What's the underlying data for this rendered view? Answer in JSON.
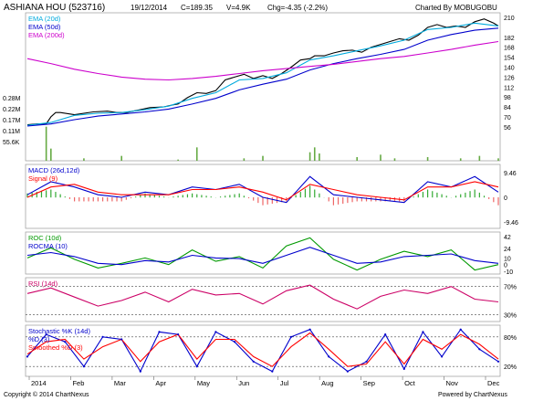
{
  "header": {
    "symbol": "ASHIANA HOU (523716)",
    "date": "19/12/2014",
    "close": "C=189.35",
    "volume": "V=4.9K",
    "change": "Chg=-4.35 (-2.2%)",
    "charted_by": "Charted By MOBUGOBU"
  },
  "footer": {
    "copyright": "Copyright © 2014 ChartNexus",
    "powered": "Powered by ChartNexus"
  },
  "x_axis": {
    "months": [
      "2014",
      "Feb",
      "Mar",
      "Apr",
      "May",
      "Jun",
      "Jul",
      "Aug",
      "Sep",
      "Oct",
      "Nov",
      "Dec"
    ]
  },
  "chart_data": [
    {
      "type": "line",
      "panel": "price",
      "legend": [
        {
          "name": "EMA (20d)",
          "color": "#00aadd"
        },
        {
          "name": "EMA (50d)",
          "color": "#0000cc"
        },
        {
          "name": "EMA (200d)",
          "color": "#cc00cc"
        }
      ],
      "y_ticks": [
        210,
        182,
        168,
        154,
        140,
        126,
        112,
        98,
        84,
        70,
        56
      ],
      "ylim": [
        48,
        214
      ],
      "volume_ticks": [
        "0.28M",
        "0.22M",
        "0.17M",
        "0.11M",
        "55.6K"
      ],
      "series": [
        {
          "name": "Price",
          "color": "#000000",
          "x": [
            0,
            0.02,
            0.04,
            0.05,
            0.06,
            0.07,
            0.1,
            0.14,
            0.17,
            0.19,
            0.21,
            0.24,
            0.26,
            0.29,
            0.31,
            0.32,
            0.34,
            0.36,
            0.38,
            0.4,
            0.42,
            0.44,
            0.46,
            0.48,
            0.5,
            0.52,
            0.54,
            0.56,
            0.58,
            0.6,
            0.61,
            0.63,
            0.65,
            0.67,
            0.69,
            0.71,
            0.73,
            0.75,
            0.77,
            0.79,
            0.81,
            0.83,
            0.85,
            0.87,
            0.89,
            0.91,
            0.93,
            0.95,
            0.97,
            0.99,
            1.0
          ],
          "values": [
            59,
            60,
            60,
            70,
            76,
            76,
            73,
            77,
            78,
            76,
            76,
            80,
            83,
            84,
            87,
            88,
            97,
            104,
            103,
            107,
            122,
            126,
            130,
            124,
            128,
            124,
            131,
            140,
            150,
            152,
            156,
            156,
            160,
            163,
            164,
            161,
            168,
            172,
            176,
            180,
            178,
            185,
            196,
            200,
            196,
            198,
            196,
            204,
            208,
            202,
            198
          ]
        },
        {
          "name": "EMA (20d)",
          "color": "#00aadd",
          "x": [
            0,
            0.05,
            0.1,
            0.15,
            0.2,
            0.25,
            0.3,
            0.35,
            0.4,
            0.45,
            0.5,
            0.55,
            0.6,
            0.65,
            0.7,
            0.75,
            0.8,
            0.85,
            0.9,
            0.95,
            1.0
          ],
          "values": [
            58,
            62,
            72,
            75,
            76,
            80,
            85,
            96,
            104,
            122,
            124,
            132,
            150,
            156,
            163,
            170,
            178,
            193,
            196,
            202,
            198
          ]
        },
        {
          "name": "EMA (50d)",
          "color": "#0000cc",
          "x": [
            0,
            0.05,
            0.1,
            0.15,
            0.2,
            0.25,
            0.3,
            0.35,
            0.4,
            0.45,
            0.5,
            0.55,
            0.6,
            0.65,
            0.7,
            0.75,
            0.8,
            0.85,
            0.9,
            0.95,
            1.0
          ],
          "values": [
            57,
            60,
            66,
            71,
            74,
            77,
            81,
            88,
            96,
            108,
            116,
            123,
            136,
            145,
            152,
            158,
            165,
            178,
            186,
            192,
            195
          ]
        },
        {
          "name": "EMA (200d)",
          "color": "#cc00cc",
          "x": [
            0,
            0.05,
            0.1,
            0.15,
            0.2,
            0.25,
            0.3,
            0.35,
            0.4,
            0.45,
            0.5,
            0.55,
            0.6,
            0.65,
            0.7,
            0.75,
            0.8,
            0.85,
            0.9,
            0.95,
            1.0
          ],
          "values": [
            152,
            145,
            137,
            131,
            126,
            123,
            122,
            124,
            127,
            131,
            135,
            138,
            141,
            144,
            148,
            152,
            155,
            160,
            165,
            171,
            176
          ]
        }
      ],
      "volume": {
        "x": [
          0.04,
          0.05,
          0.12,
          0.2,
          0.32,
          0.36,
          0.46,
          0.5,
          0.6,
          0.61,
          0.62,
          0.7,
          0.75,
          0.78,
          0.85,
          0.92,
          0.96,
          1.0
        ],
        "values": [
          0.28,
          0.1,
          0.02,
          0.04,
          0.01,
          0.11,
          0.02,
          0.04,
          0.07,
          0.11,
          0.06,
          0.03,
          0.05,
          0.02,
          0.03,
          0.02,
          0.04,
          0.02
        ]
      }
    },
    {
      "type": "line",
      "panel": "macd",
      "legend": [
        {
          "name": "MACD (26d,12d)",
          "color": "#0000cc"
        },
        {
          "name": "Signal (9)",
          "color": "#ff0000"
        }
      ],
      "y_ticks": [
        9.46,
        0,
        -9.46
      ],
      "ylim": [
        -12,
        12
      ],
      "series": [
        {
          "name": "MACD (26d,12d)",
          "color": "#0000cc",
          "x": [
            0,
            0.05,
            0.1,
            0.15,
            0.2,
            0.25,
            0.3,
            0.35,
            0.4,
            0.45,
            0.5,
            0.55,
            0.6,
            0.65,
            0.7,
            0.75,
            0.8,
            0.85,
            0.9,
            0.95,
            1.0
          ],
          "values": [
            1,
            6,
            4,
            1,
            0,
            2,
            1,
            4,
            3,
            5,
            0,
            -2,
            8,
            1,
            0,
            -1,
            -2,
            6,
            4,
            8,
            2
          ]
        },
        {
          "name": "Signal (9)",
          "color": "#ff0000",
          "x": [
            0,
            0.05,
            0.1,
            0.15,
            0.2,
            0.25,
            0.3,
            0.35,
            0.4,
            0.45,
            0.5,
            0.55,
            0.6,
            0.65,
            0.7,
            0.75,
            0.8,
            0.85,
            0.9,
            0.95,
            1.0
          ],
          "values": [
            0,
            4,
            5,
            2,
            1,
            1,
            1,
            3,
            3,
            4,
            2,
            -1,
            5,
            3,
            1,
            0,
            -1,
            4,
            4,
            6,
            4
          ]
        }
      ]
    },
    {
      "type": "line",
      "panel": "roc",
      "legend": [
        {
          "name": "ROC (10d)",
          "color": "#009900"
        },
        {
          "name": "ROCMA (10)",
          "color": "#0000cc"
        }
      ],
      "y_ticks": [
        42,
        24,
        10,
        0,
        -10
      ],
      "ylim": [
        -14,
        46
      ],
      "series": [
        {
          "name": "ROC (10d)",
          "color": "#009900",
          "x": [
            0,
            0.05,
            0.1,
            0.15,
            0.2,
            0.25,
            0.3,
            0.35,
            0.4,
            0.45,
            0.5,
            0.55,
            0.6,
            0.65,
            0.7,
            0.75,
            0.8,
            0.85,
            0.9,
            0.95,
            1.0
          ],
          "values": [
            10,
            25,
            8,
            -5,
            2,
            10,
            0,
            22,
            5,
            12,
            -5,
            28,
            40,
            8,
            -8,
            8,
            20,
            12,
            22,
            -8,
            0
          ]
        },
        {
          "name": "ROCMA (10)",
          "color": "#0000cc",
          "x": [
            0,
            0.05,
            0.1,
            0.15,
            0.2,
            0.25,
            0.3,
            0.35,
            0.4,
            0.45,
            0.5,
            0.55,
            0.6,
            0.65,
            0.7,
            0.75,
            0.8,
            0.85,
            0.9,
            0.95,
            1.0
          ],
          "values": [
            14,
            18,
            12,
            2,
            0,
            6,
            4,
            14,
            10,
            9,
            2,
            14,
            26,
            14,
            2,
            4,
            12,
            14,
            16,
            6,
            2
          ]
        }
      ]
    },
    {
      "type": "line",
      "panel": "rsi",
      "legend": [
        {
          "name": "RSI (14d)",
          "color": "#cc0066"
        }
      ],
      "y_ticks": [
        "70%",
        "30%"
      ],
      "ylim": [
        20,
        80
      ],
      "series": [
        {
          "name": "RSI (14d)",
          "color": "#cc0066",
          "x": [
            0,
            0.05,
            0.1,
            0.15,
            0.2,
            0.25,
            0.3,
            0.35,
            0.4,
            0.45,
            0.5,
            0.55,
            0.6,
            0.65,
            0.7,
            0.75,
            0.8,
            0.85,
            0.9,
            0.95,
            1.0
          ],
          "values": [
            60,
            68,
            55,
            42,
            50,
            62,
            48,
            66,
            58,
            60,
            45,
            64,
            72,
            52,
            38,
            56,
            65,
            60,
            70,
            52,
            48
          ]
        }
      ]
    },
    {
      "type": "line",
      "panel": "stochastic",
      "legend": [
        {
          "name": "Stochastic %K (14d)",
          "color": "#0000cc"
        },
        {
          "name": "%D (3)",
          "color": "#0000cc"
        },
        {
          "name": "Smoothed %D (3)",
          "color": "#ff0000"
        }
      ],
      "y_ticks": [
        "80%",
        "20%"
      ],
      "ylim": [
        0,
        100
      ],
      "series": [
        {
          "name": "%K",
          "color": "#0000cc",
          "x": [
            0,
            0.04,
            0.08,
            0.12,
            0.16,
            0.2,
            0.24,
            0.28,
            0.32,
            0.36,
            0.4,
            0.44,
            0.48,
            0.52,
            0.56,
            0.6,
            0.64,
            0.68,
            0.72,
            0.76,
            0.8,
            0.84,
            0.88,
            0.92,
            0.96,
            1.0
          ],
          "values": [
            40,
            85,
            70,
            20,
            80,
            75,
            10,
            90,
            85,
            20,
            90,
            70,
            30,
            10,
            80,
            95,
            40,
            10,
            30,
            85,
            15,
            90,
            40,
            95,
            55,
            30
          ]
        },
        {
          "name": "Smoothed %D (3)",
          "color": "#ff0000",
          "x": [
            0,
            0.04,
            0.08,
            0.12,
            0.16,
            0.2,
            0.24,
            0.28,
            0.32,
            0.36,
            0.4,
            0.44,
            0.48,
            0.52,
            0.56,
            0.6,
            0.64,
            0.68,
            0.72,
            0.76,
            0.8,
            0.84,
            0.88,
            0.92,
            0.96,
            1.0
          ],
          "values": [
            45,
            70,
            75,
            35,
            60,
            75,
            30,
            70,
            85,
            35,
            75,
            75,
            40,
            20,
            60,
            88,
            55,
            20,
            25,
            70,
            25,
            75,
            55,
            85,
            65,
            35
          ]
        }
      ]
    }
  ]
}
